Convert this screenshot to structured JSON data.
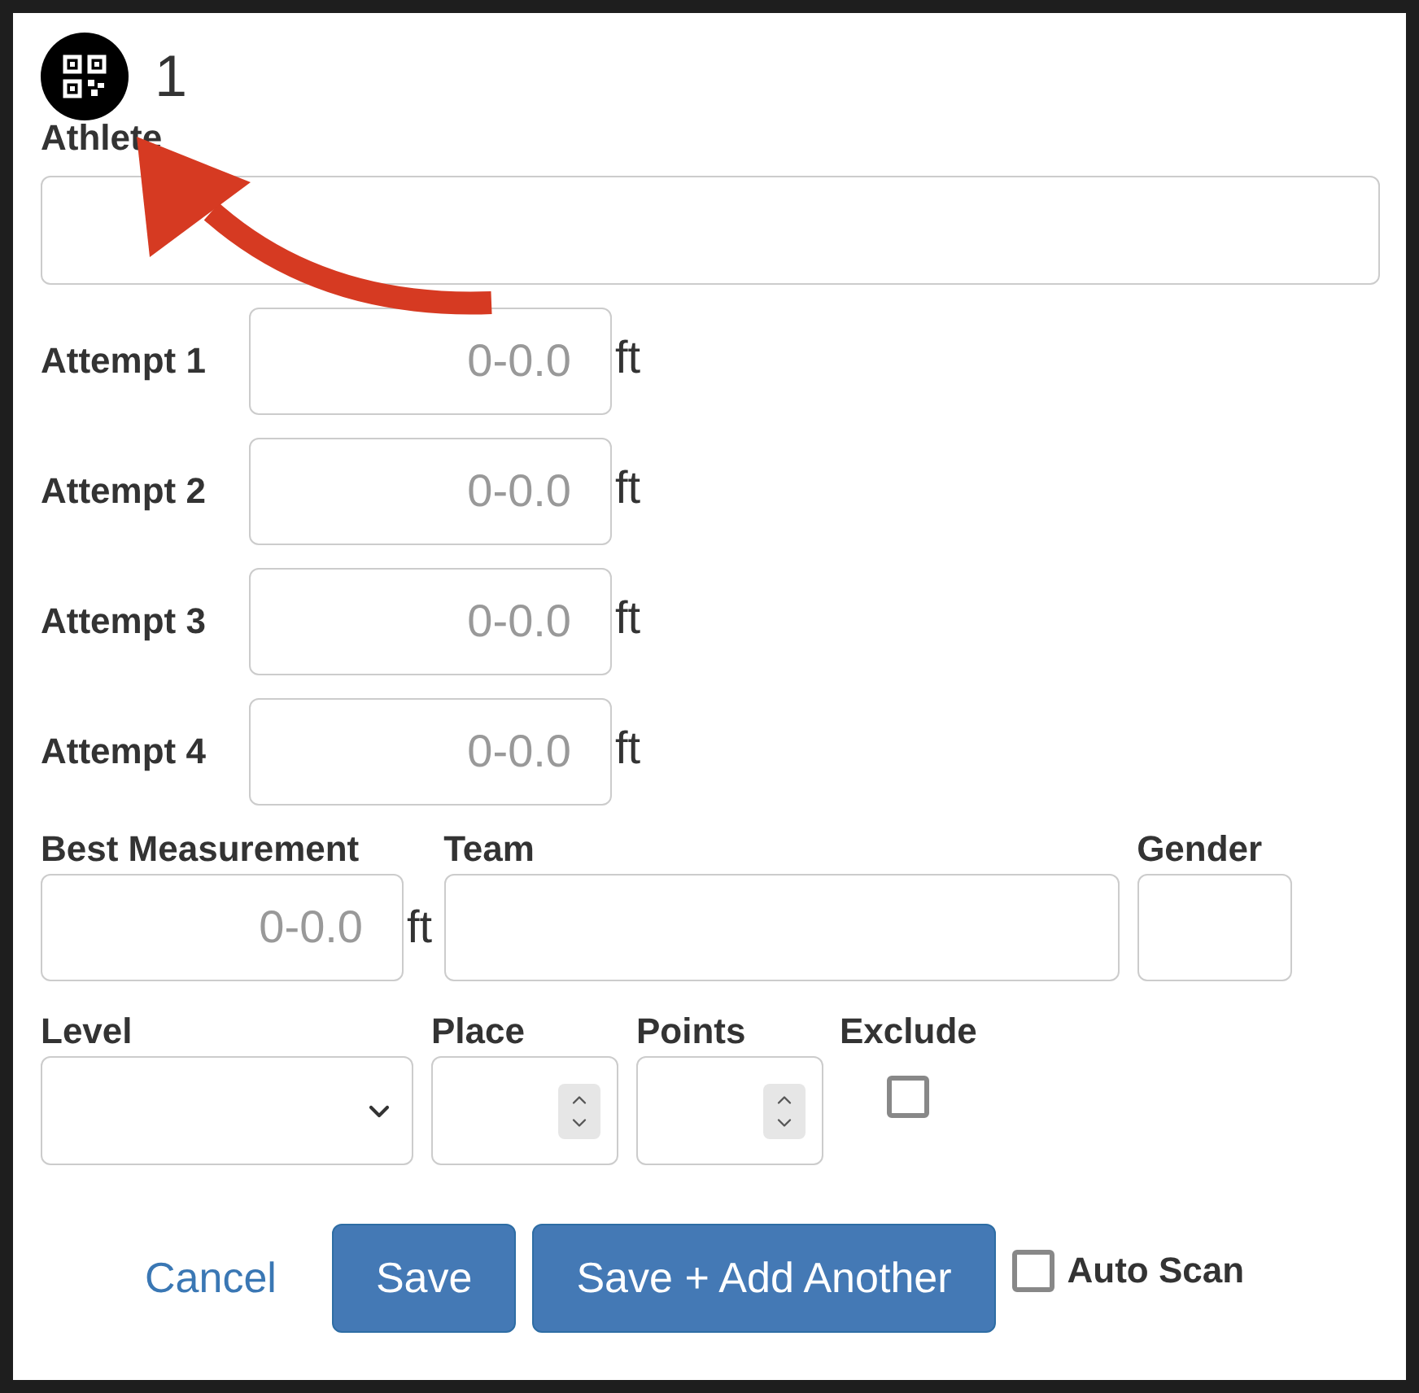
{
  "header": {
    "number": "1"
  },
  "athlete": {
    "label": "Athlete"
  },
  "attempts": [
    {
      "label": "Attempt 1",
      "placeholder": "0-0.0",
      "unit": "ft"
    },
    {
      "label": "Attempt 2",
      "placeholder": "0-0.0",
      "unit": "ft"
    },
    {
      "label": "Attempt 3",
      "placeholder": "0-0.0",
      "unit": "ft"
    },
    {
      "label": "Attempt 4",
      "placeholder": "0-0.0",
      "unit": "ft"
    }
  ],
  "best_measurement": {
    "label": "Best Measurement",
    "placeholder": "0-0.0",
    "unit": "ft"
  },
  "team": {
    "label": "Team"
  },
  "gender": {
    "label": "Gender"
  },
  "level": {
    "label": "Level"
  },
  "place": {
    "label": "Place"
  },
  "points": {
    "label": "Points"
  },
  "exclude": {
    "label": "Exclude",
    "checked": false
  },
  "buttons": [
    {
      "kind": "link",
      "label": "Cancel"
    },
    {
      "kind": "primary",
      "label": "Save"
    },
    {
      "kind": "primary",
      "label": "Save + Add Another"
    }
  ],
  "auto_scan": {
    "label": "Auto Scan",
    "checked": false
  }
}
